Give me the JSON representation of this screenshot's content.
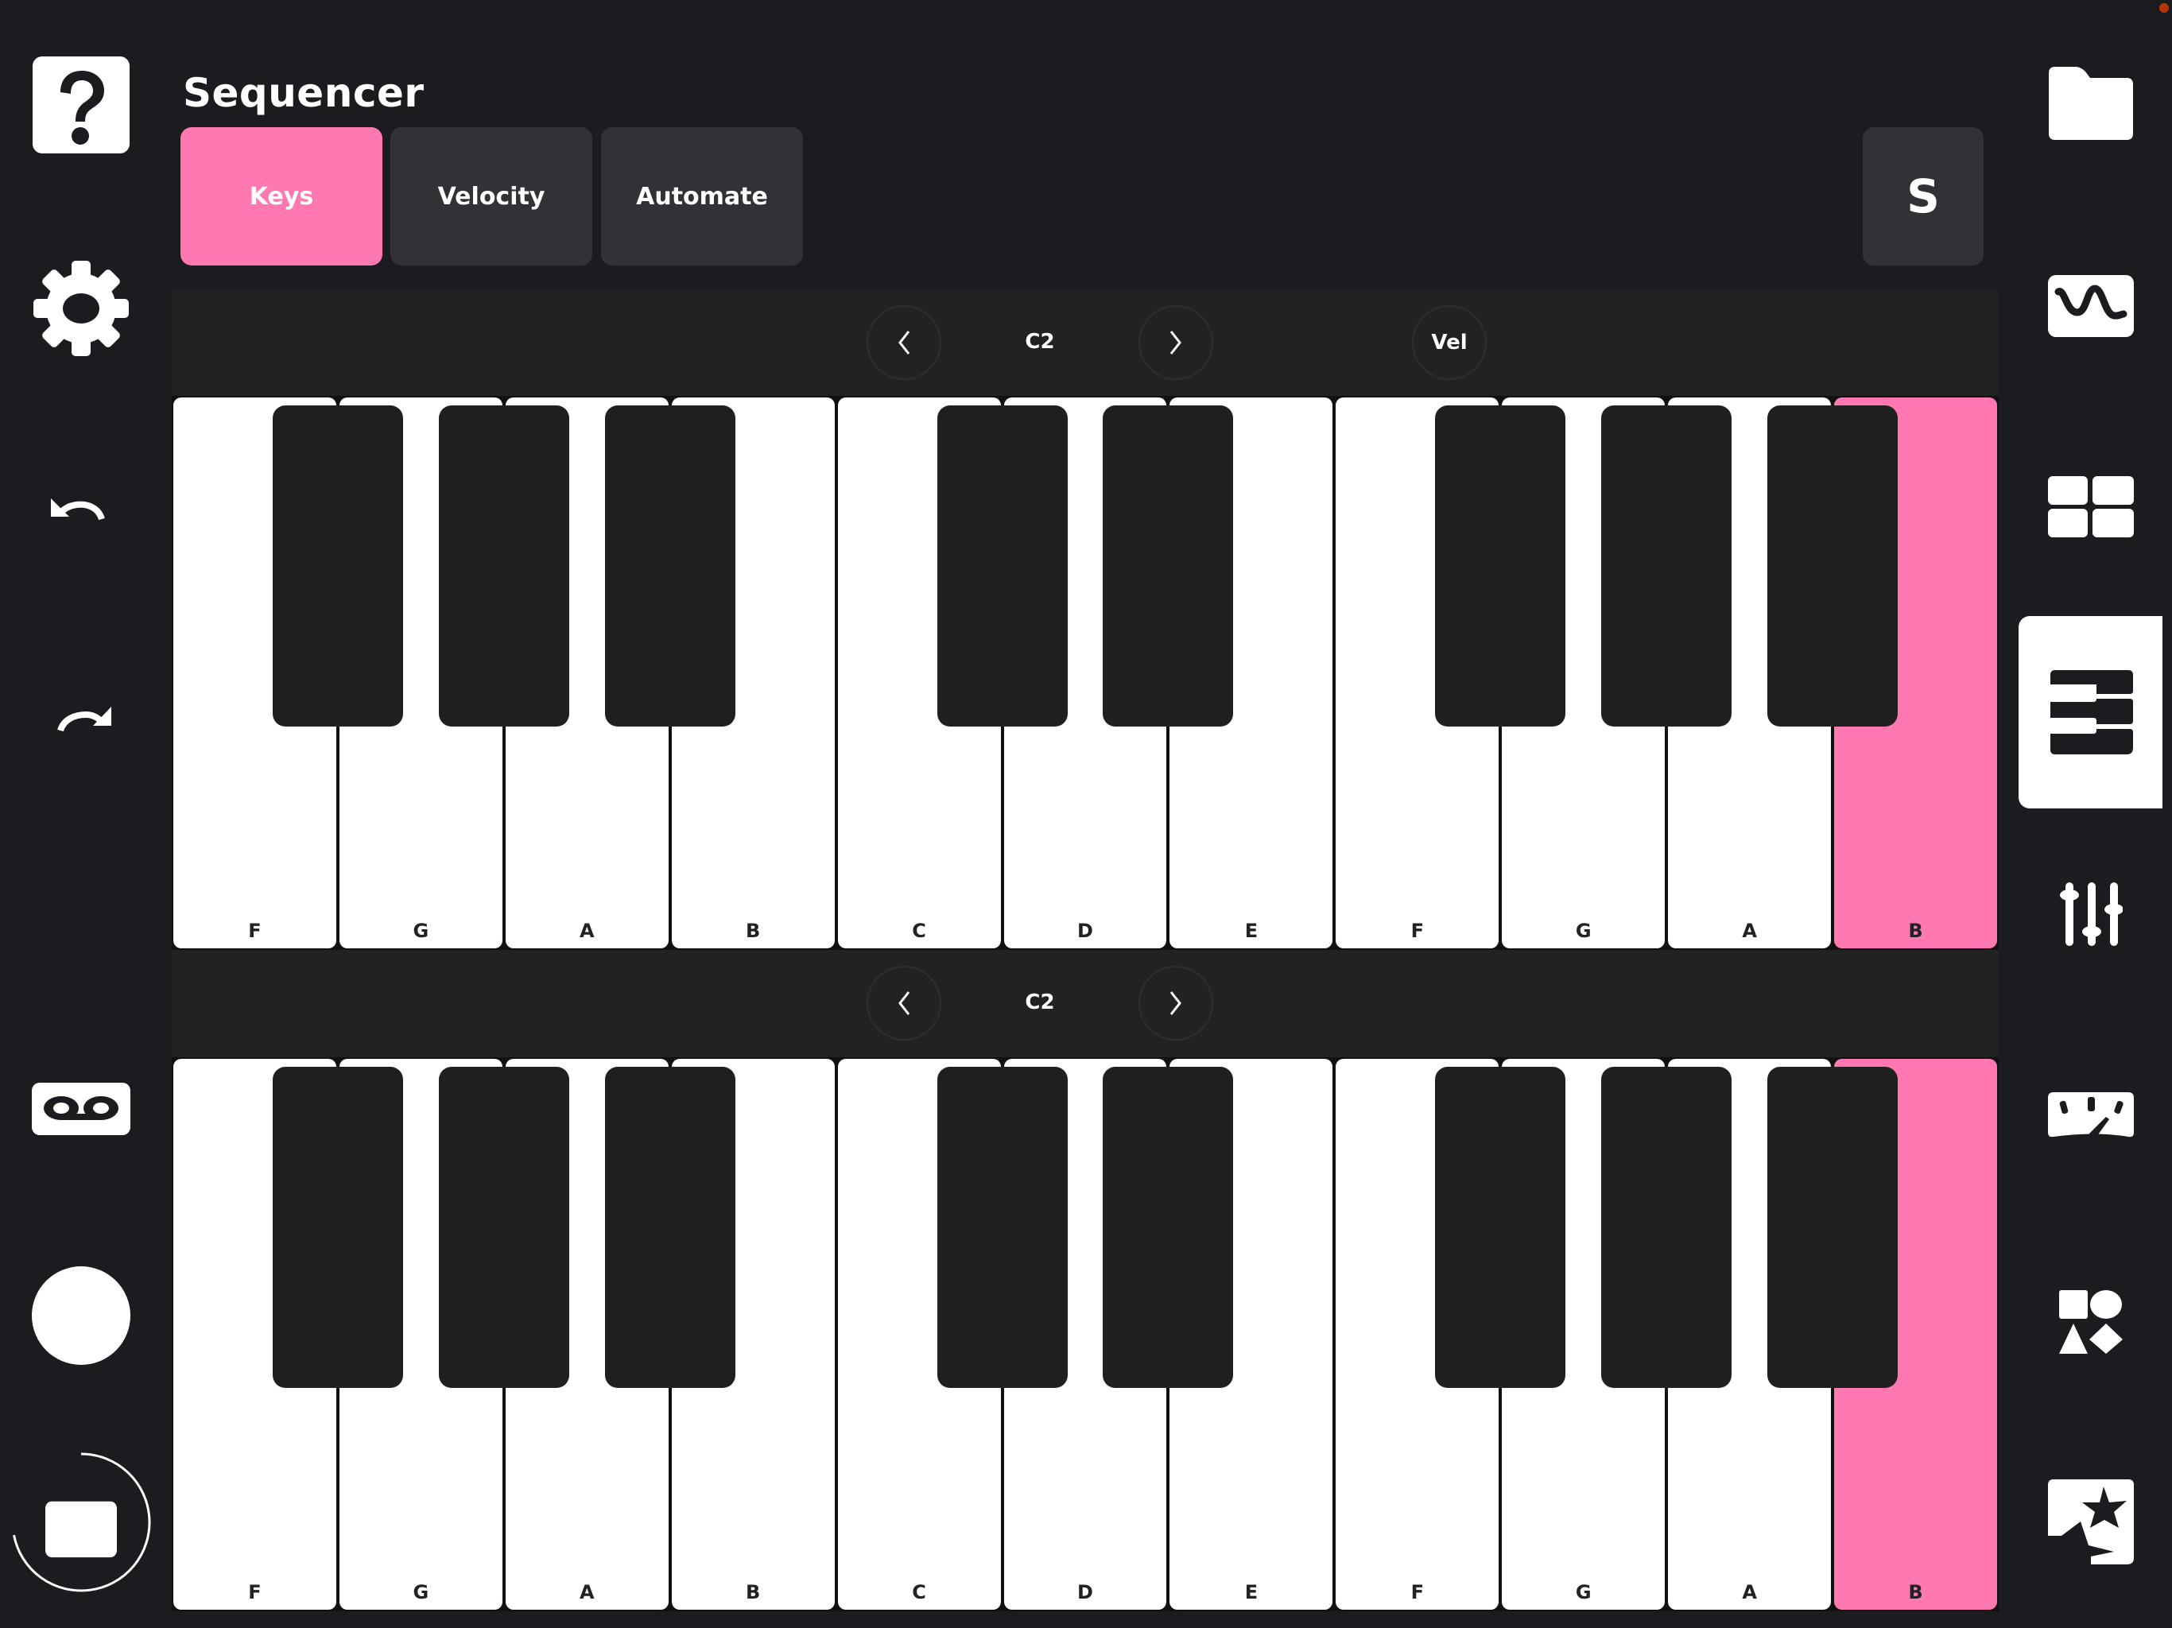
{
  "header": {
    "title": "Sequencer"
  },
  "tabs": [
    {
      "label": "Keys",
      "active": true
    },
    {
      "label": "Velocity",
      "active": false
    },
    {
      "label": "Automate",
      "active": false
    }
  ],
  "toolbar": {
    "s_button_label": "S"
  },
  "left_sidebar": {
    "items": [
      {
        "icon": "help-icon",
        "label": "Help"
      },
      {
        "icon": "gear-icon",
        "label": "Settings"
      },
      {
        "icon": "undo-icon",
        "label": "Undo"
      },
      {
        "icon": "redo-icon",
        "label": "Redo"
      },
      {
        "icon": "tape-icon",
        "label": "Recordings"
      },
      {
        "icon": "record-icon",
        "label": "Record"
      },
      {
        "icon": "stop-icon",
        "label": "Stop"
      }
    ],
    "stop_progress_ring": 0.72
  },
  "right_sidebar": {
    "items": [
      {
        "icon": "folder-icon",
        "label": "Files",
        "selected": false
      },
      {
        "icon": "wave-icon",
        "label": "Oscillator",
        "selected": false
      },
      {
        "icon": "pads-icon",
        "label": "Pads",
        "selected": false
      },
      {
        "icon": "piano-icon",
        "label": "Sequencer",
        "selected": true
      },
      {
        "icon": "mixer-icon",
        "label": "Mixer",
        "selected": false
      },
      {
        "icon": "meter-icon",
        "label": "Meter",
        "selected": false
      },
      {
        "icon": "shapes-icon",
        "label": "Shapes",
        "selected": false
      },
      {
        "icon": "effects-icon",
        "label": "Effects",
        "selected": false
      }
    ]
  },
  "keyboards": [
    {
      "octave_label": "C2",
      "prev_label": "‹",
      "next_label": "›",
      "velocity_button": "Vel",
      "white_keys": [
        "F",
        "G",
        "A",
        "B",
        "C",
        "D",
        "E",
        "F",
        "G",
        "A",
        "B"
      ],
      "active_keys": [
        10
      ]
    },
    {
      "octave_label": "C2",
      "prev_label": "‹",
      "next_label": "›",
      "white_keys": [
        "F",
        "G",
        "A",
        "B",
        "C",
        "D",
        "E",
        "F",
        "G",
        "A",
        "B"
      ],
      "active_keys": [
        10
      ]
    }
  ],
  "colors": {
    "accent": "#ff78b1",
    "background": "#1c1c20",
    "panel": "#222224",
    "button": "#313136",
    "status_dot": "#b8350a"
  }
}
